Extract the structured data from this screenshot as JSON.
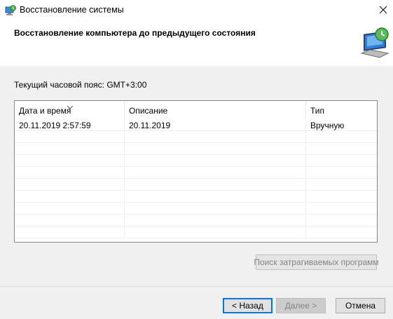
{
  "window": {
    "title": "Восстановление системы",
    "icons": {
      "app": "system-restore-icon",
      "close": "close-icon",
      "header": "computer-restore-icon"
    }
  },
  "header": {
    "title": "Восстановление компьютера до предыдущего состояния"
  },
  "timezone_label": "Текущий часовой пояс: GMT+3:00",
  "table": {
    "columns": [
      "Дата и время",
      "Описание",
      "Тип"
    ],
    "sorted_column": "Дата и время",
    "rows": [
      {
        "date": "20.11.2019 2:57:59",
        "description": "20.11.2019",
        "type": "Вручную"
      }
    ]
  },
  "buttons": {
    "affected_programs": "Поиск затрагиваемых программ",
    "back": "< Назад",
    "next": "Далее >",
    "cancel": "Отмена"
  },
  "colors": {
    "accent": "#0078d7",
    "window_bg": "#f0f0f0",
    "disabled_text": "#838383"
  }
}
